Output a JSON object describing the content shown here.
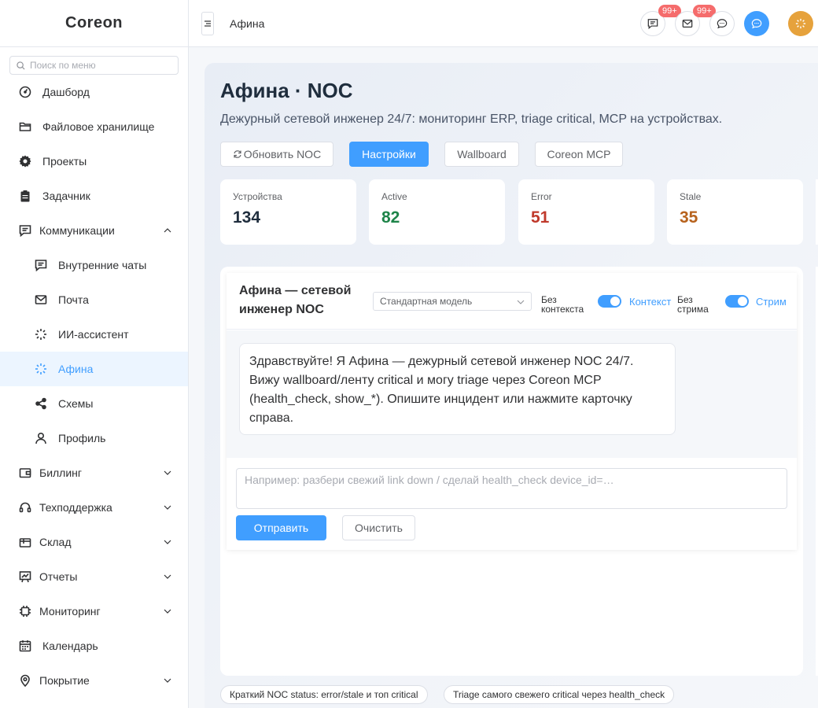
{
  "app": {
    "name": "Coreon"
  },
  "sidebar": {
    "search_placeholder": "Поиск по меню",
    "items": [
      {
        "label": "Дашборд",
        "icon": "dashboard-icon"
      },
      {
        "label": "Файловое хранилище",
        "icon": "folder-icon"
      },
      {
        "label": "Проекты",
        "icon": "gear-icon"
      },
      {
        "label": "Задачник",
        "icon": "clipboard-icon"
      },
      {
        "label": "Коммуникации",
        "icon": "message-square-icon",
        "expanded": true
      },
      {
        "label": "Внутренние чаты",
        "icon": "chat-lines-icon"
      },
      {
        "label": "Почта",
        "icon": "mail-icon"
      },
      {
        "label": "ИИ-ассистент",
        "icon": "spinner-icon"
      },
      {
        "label": "Афина",
        "icon": "spinner-icon",
        "active": true
      },
      {
        "label": "Схемы",
        "icon": "share-icon"
      },
      {
        "label": "Профиль",
        "icon": "user-icon"
      },
      {
        "label": "Биллинг",
        "icon": "wallet-icon"
      },
      {
        "label": "Техподдержка",
        "icon": "headset-icon"
      },
      {
        "label": "Склад",
        "icon": "box-icon"
      },
      {
        "label": "Отчеты",
        "icon": "chart-board-icon"
      },
      {
        "label": "Мониторинг",
        "icon": "cpu-icon"
      },
      {
        "label": "Календарь",
        "icon": "calendar-icon"
      },
      {
        "label": "Покрытие",
        "icon": "location-icon"
      }
    ]
  },
  "topbar": {
    "breadcrumb": "Афина",
    "chat_badge": "99+",
    "mail_badge": "99+"
  },
  "page": {
    "title": "Афина · NOC",
    "subtitle": "Дежурный сетевой инженер 24/7: мониторинг ERP, triage critical, MCP на устройствах.",
    "buttons": {
      "refresh": "Обновить NOC",
      "settings": "Настройки",
      "wallboard": "Wallboard",
      "mcp": "Coreon MCP"
    }
  },
  "stats": [
    {
      "label": "Устройства",
      "value": "134",
      "color": "#1f2d3d"
    },
    {
      "label": "Active",
      "value": "82",
      "color": "#1e8449"
    },
    {
      "label": "Error",
      "value": "51",
      "color": "#c0392b"
    },
    {
      "label": "Stale",
      "value": "35",
      "color": "#b7621d"
    }
  ],
  "chat": {
    "title": "Афина — сетевой инженер NOC",
    "model": "Стандартная модель",
    "toggle_context_off": "Без контекста",
    "toggle_context_on": "Контекст",
    "toggle_stream_off": "Без стрима",
    "toggle_stream_on": "Стрим",
    "context_enabled": true,
    "stream_enabled": true,
    "greeting": "Здравствуйте! Я Афина — дежурный сетевой инженер NOC 24/7. Вижу wallboard/ленту critical и могу triage через Coreon MCP (health_check, show_*). Опишите инцидент или нажмите карточку справа.",
    "input_placeholder": "Например: разбери свежий link down / сделай health_check device_id=…",
    "send": "Отправить",
    "clear": "Очистить"
  },
  "quick_prompts": [
    "Краткий NOC status: error/stale и топ critical",
    "Triage самого свежего critical через health_check"
  ],
  "colors": {
    "accent": "#409eff",
    "avatar": "#e6a23c",
    "badge": "#f56c6c"
  }
}
